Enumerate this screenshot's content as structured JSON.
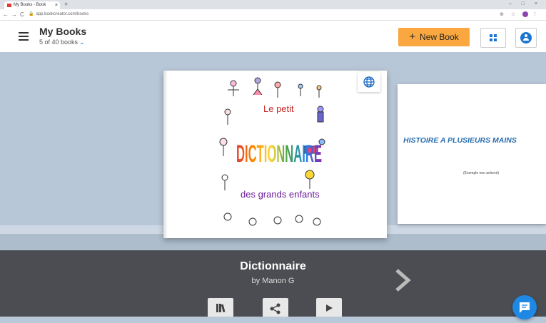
{
  "browser": {
    "tab_title": "My Books - Book Creator",
    "new_tab": "+",
    "url": "app.bookcreator.com/books",
    "window_controls": "–  □  ×"
  },
  "header": {
    "title": "My Books",
    "subtitle": "5 of 40 books",
    "new_book_label": "New Book"
  },
  "covers": {
    "next_book_title": "HISTOIRE A PLUSIEURS MAINS",
    "next_book_subtitle": "(Exemple non achevé)",
    "main_cover_words": [
      "Le petit",
      "DICTIONNAIRE",
      "des grands enfants"
    ]
  },
  "current_book": {
    "title": "Dictionnaire",
    "author": "by Manon G"
  },
  "colors": {
    "accent_orange": "#f9a73e",
    "accent_blue": "#1976d2",
    "info_bar": "#4b4d52",
    "stage": "#b8c7d8"
  },
  "icons": [
    "menu-icon",
    "chevron-down-icon",
    "plus-icon",
    "grid-icon",
    "account-icon",
    "globe-icon",
    "chevron-right-icon",
    "library-icon",
    "share-icon",
    "play-icon",
    "chat-icon"
  ]
}
